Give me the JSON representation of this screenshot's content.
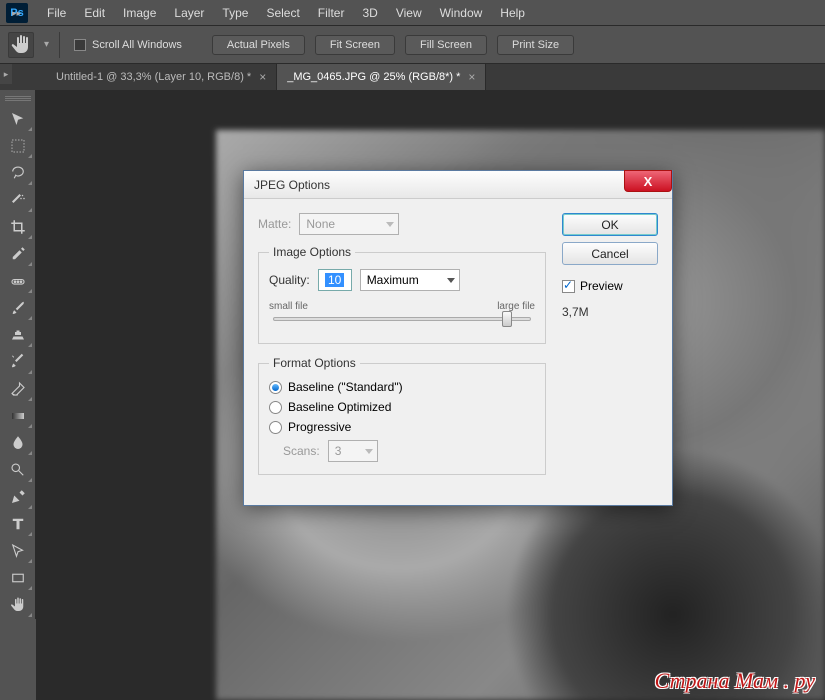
{
  "app": {
    "icon_label": "Ps"
  },
  "menu": [
    "File",
    "Edit",
    "Image",
    "Layer",
    "Type",
    "Select",
    "Filter",
    "3D",
    "View",
    "Window",
    "Help"
  ],
  "options": {
    "scroll_all": "Scroll All Windows",
    "buttons": [
      "Actual Pixels",
      "Fit Screen",
      "Fill Screen",
      "Print Size"
    ]
  },
  "tabs": [
    {
      "label": "Untitled-1 @ 33,3% (Layer 10, RGB/8) *",
      "active": false
    },
    {
      "label": "_MG_0465.JPG @ 25% (RGB/8*) *",
      "active": true
    }
  ],
  "dialog": {
    "title": "JPEG Options",
    "matte_label": "Matte:",
    "matte_value": "None",
    "image_options_legend": "Image Options",
    "quality_label": "Quality:",
    "quality_value": "10",
    "quality_preset": "Maximum",
    "small_file": "small file",
    "large_file": "large file",
    "format_options_legend": "Format Options",
    "format_baseline_std": "Baseline (\"Standard\")",
    "format_baseline_opt": "Baseline Optimized",
    "format_progressive": "Progressive",
    "scans_label": "Scans:",
    "scans_value": "3",
    "ok": "OK",
    "cancel": "Cancel",
    "preview": "Preview",
    "filesize": "3,7M"
  },
  "watermark": "Страна Мам . ру"
}
